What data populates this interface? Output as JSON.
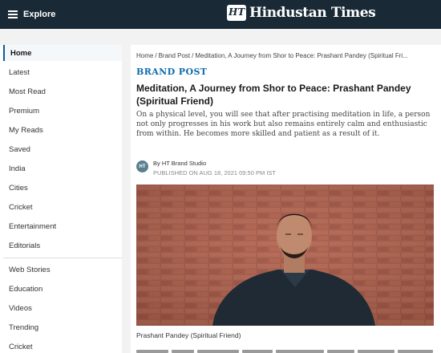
{
  "header": {
    "menu_label": "Explore",
    "brand_badge": "HT",
    "brand_name": "Hindustan Times",
    "background": "#192a36"
  },
  "sidebar": {
    "items": [
      {
        "label": "Home",
        "active": true
      },
      {
        "label": "Latest"
      },
      {
        "label": "Most Read"
      },
      {
        "label": "Premium"
      },
      {
        "label": "My Reads"
      },
      {
        "label": "Saved"
      },
      {
        "label": "India"
      },
      {
        "label": "Cities"
      },
      {
        "label": "Cricket"
      },
      {
        "label": "Entertainment"
      },
      {
        "label": "Editorials"
      },
      {
        "label": "Web Stories"
      },
      {
        "label": "Education"
      },
      {
        "label": "Videos"
      },
      {
        "label": "Trending"
      },
      {
        "label": "Cricket"
      }
    ]
  },
  "breadcrumb": {
    "items": [
      "Home",
      "Brand Post",
      "Meditation, A Journey from Shor to Peace: Prashant Pandey (Spiritual Fri..."
    ],
    "separator": "/"
  },
  "article": {
    "section": "BRAND POST",
    "title": "Meditation, A Journey from Shor to Peace: Prashant Pandey (Spiritual Friend)",
    "summary": "On a physical level, you will see that after practising meditation in life, a person not only progresses in his work but also remains entirely calm and enthusiastic from within. He becomes more skilled and patient as a result of it.",
    "studio_badge": "HT",
    "author": "By HT Brand Studio",
    "published": "PUBLISHED ON AUG 18, 2021 09:50 PM IST",
    "photo_caption": "Prashant Pandey (Spiritual Friend)"
  },
  "colors": {
    "accent": "#0d6aad",
    "active_border": "#0d5e98"
  }
}
